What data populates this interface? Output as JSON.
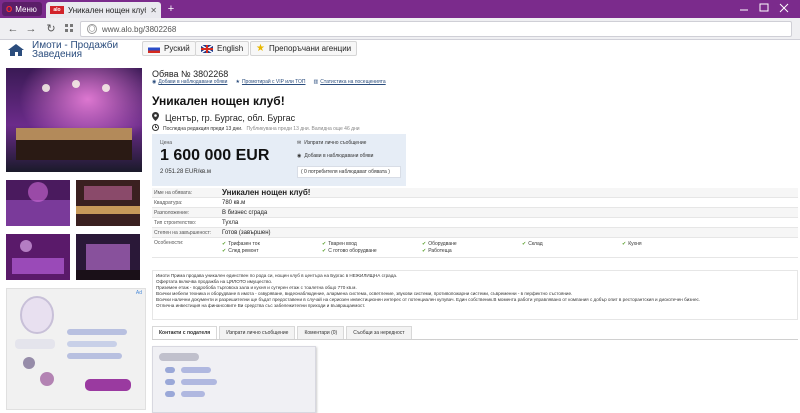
{
  "browser": {
    "menu_label": "Меню",
    "tab_title": "Уникален нощен клуб!",
    "tab_favicon_text": "alo",
    "url": "www.alo.bg/3802268"
  },
  "header": {
    "brand_line1": "Имоти - Продажби",
    "brand_line2": "Заведения",
    "lang_ru": "Руский",
    "lang_en": "English",
    "recommended": "Препоръчани агенции"
  },
  "listing": {
    "ad_number": "Обява № 3802268",
    "actions": [
      "Добави в наблюдавани обяви",
      "Промотирай с VIP или ТОП",
      "Статистика на посещенията"
    ],
    "title": "Уникален нощен клуб!",
    "location": "Център, гр. Бургас, обл. Бургас",
    "last_edit": "Последна редакция преди 13 дни.",
    "published": "Публикувана преди 13 дни. Валидна още 46 дни"
  },
  "price": {
    "label": "Цена",
    "value": "1 600 000 EUR",
    "per_sqm": "2 051.28 EUR/кв.м",
    "send_message": "Изпрати лично съобщение",
    "add_watch": "Добави в наблюдавани обяви",
    "watchers": "( 0 потребителя наблюдават обявата )"
  },
  "details": [
    {
      "key": "Име на обявата:",
      "value": "Уникален нощен клуб!",
      "big": true
    },
    {
      "key": "Квадратура:",
      "value": "780 кв.м",
      "big": false
    },
    {
      "key": "Разположение:",
      "value": "В бизнес сграда",
      "big": false
    },
    {
      "key": "Тип строителство:",
      "value": "Тухла",
      "big": false
    },
    {
      "key": "Степен на завършеност:",
      "value": "Готов (завършен)",
      "big": false
    }
  ],
  "features": {
    "key": "Особености:",
    "items": [
      "Трифазен ток",
      "Тварен вход",
      "Оборудване",
      "Склад",
      "Кухня",
      "След ремонт",
      "С готово оборудване",
      "Работеща"
    ]
  },
  "description": [
    "Имоти Прима продава уникален единствен по рода си, нощен клуб в центъра на Бургас в НЕЖИЛИЩНА сграда.",
    "Офертата включва продажба на ЦЯЛОТО имущество.",
    "Приземен етаж - подробоба търговска зала и кухня и сутерен етаж с тоалетна общо 770 кв.м.",
    "Всички мебели техника и оборудване в имота - озвуряване, видеонаблюдение, алармена система, осветление, звукови системи, противопожарни системи, съвременни - в перфектно състояние.",
    "Всички налични документи и разрешителни ще бъдат предоставени в случай на сериозен инвестиционен интерес от потенциален купувач. Един собственик.В момента работи управлявано от компания с добър опит в ресторантския и дискотечен бизнес.",
    "Отлична инвестиция на финансовите Ви средства със забележителни приходи и възвращаемост."
  ],
  "tabs": [
    "Контакти с подателя",
    "Изпрати лично съобщение",
    "Коментари (0)",
    "Съобщи за нередност"
  ],
  "ad_label": "Ad",
  "colors": {
    "browser_purple": "#7b2b8c",
    "brand_blue": "#2b4d7d",
    "price_box": "#e6edf6",
    "check_green": "#5aa02c"
  }
}
